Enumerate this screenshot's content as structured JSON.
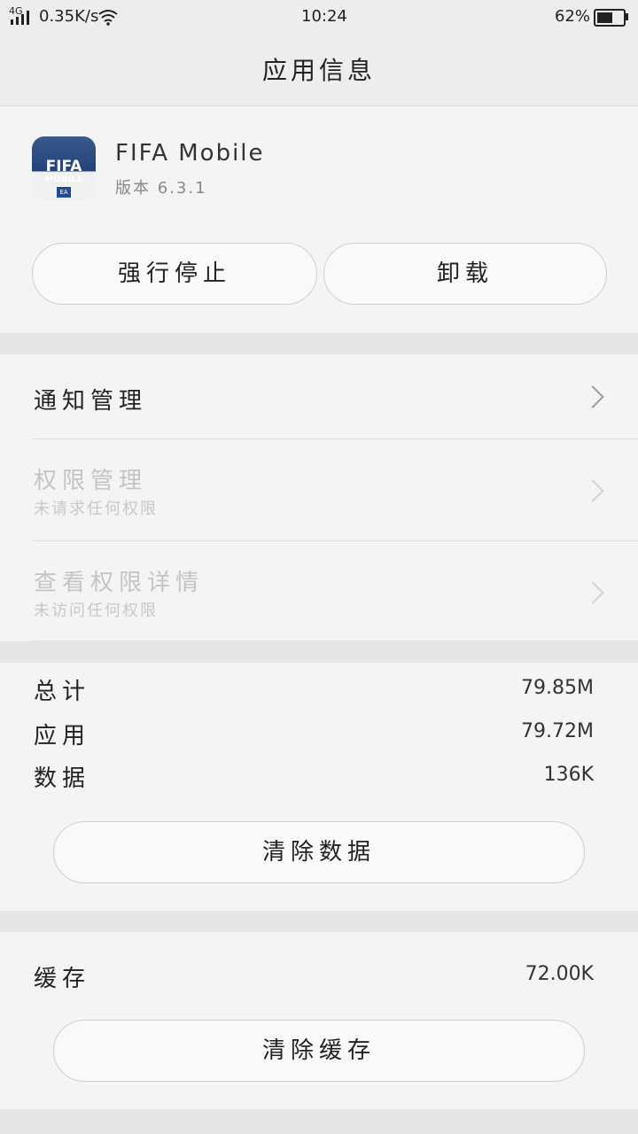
{
  "status_bar": {
    "network": "4G",
    "speed": "0.35K/s",
    "time": "10:24",
    "battery_percent": "62%",
    "battery_level": 0.62,
    "icons": [
      "signal-icon",
      "wifi-icon",
      "battery-icon"
    ]
  },
  "header": {
    "title": "应用信息"
  },
  "app": {
    "name": "FIFA Mobile",
    "version": "版本 6.3.1",
    "icon": {
      "line1": "FIFA",
      "line2": "MOBILE",
      "badge": "EA"
    }
  },
  "actions": {
    "force_stop": "强行停止",
    "uninstall": "卸载"
  },
  "settings": {
    "notification": {
      "label": "通知管理"
    },
    "permission": {
      "label": "权限管理",
      "sub": "未请求任何权限"
    },
    "permission_detail": {
      "label": "查看权限详情",
      "sub": "未访问任何权限"
    }
  },
  "storage": {
    "total_label": "总计",
    "total_value": "79.85M",
    "app_label": "应用",
    "app_value": "79.72M",
    "data_label": "数据",
    "data_value": "136K",
    "clear_data": "清除数据"
  },
  "cache": {
    "label": "缓存",
    "value": "72.00K",
    "clear_cache": "清除缓存"
  },
  "colors": {
    "background": "#f4f4f4",
    "separator": "#e6e6e6",
    "button_border": "#cfcfcf",
    "disabled_text": "#c4c4c4"
  }
}
